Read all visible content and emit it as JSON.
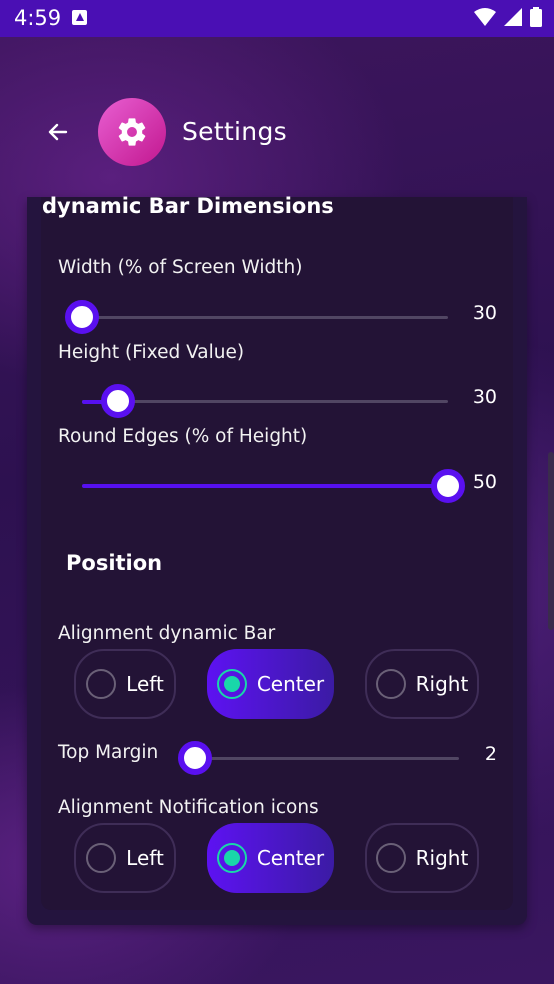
{
  "status_bar": {
    "time": "4:59"
  },
  "header": {
    "title": "Settings"
  },
  "dimensions": {
    "section_title": "dynamic Bar Dimensions",
    "width": {
      "label": "Width (% of Screen Width)",
      "value": "30"
    },
    "height": {
      "label": "Height (Fixed Value)",
      "value": "30"
    },
    "round_edges": {
      "label": "Round Edges (% of Height)",
      "value": "50"
    }
  },
  "position": {
    "section_title": "Position",
    "alignment_bar": {
      "label": "Alignment dynamic Bar",
      "options": [
        "Left",
        "Center",
        "Right"
      ],
      "selected": "Center"
    },
    "top_margin": {
      "label": "Top Margin",
      "value": "2"
    },
    "alignment_icons": {
      "label": "Alignment Notification icons",
      "options": [
        "Left",
        "Center",
        "Right"
      ],
      "selected": "Center"
    }
  },
  "colors": {
    "accent": "#5a10f0",
    "radio_selected": "#19d7a9",
    "status_bar": "#4a0fb4",
    "app_icon": "#d63aac"
  }
}
